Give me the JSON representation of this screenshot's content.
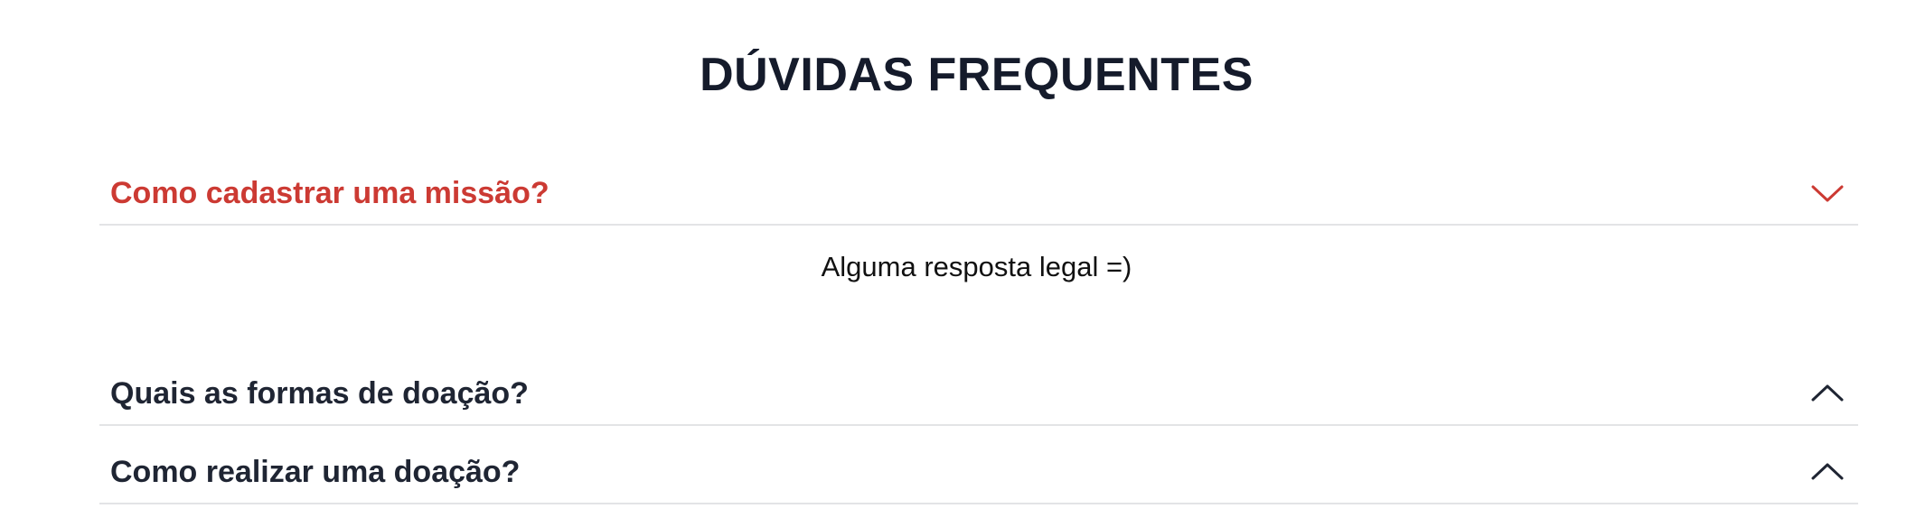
{
  "faq": {
    "title": "DÚVIDAS FREQUENTES",
    "accent_color": "#cc3a33",
    "text_color": "#1f2533",
    "items": [
      {
        "question": "Como cadastrar uma missão?",
        "answer": "Alguma resposta legal =)",
        "expanded": true,
        "icon": "chevron-down-icon"
      },
      {
        "question": "Quais as formas de doação?",
        "expanded": false,
        "icon": "chevron-up-icon"
      },
      {
        "question": "Como realizar uma doação?",
        "expanded": false,
        "icon": "chevron-up-icon"
      }
    ]
  }
}
